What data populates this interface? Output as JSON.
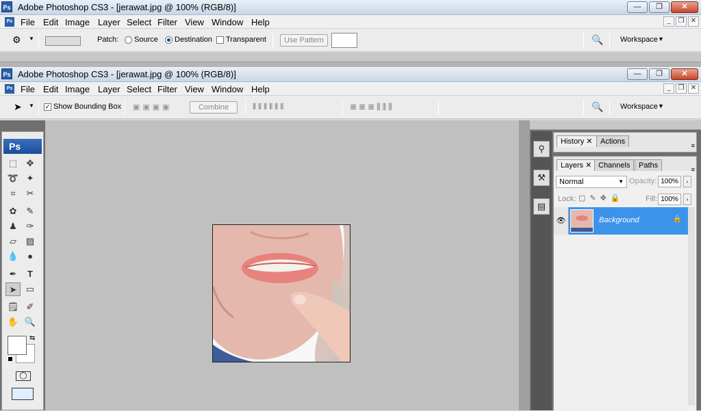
{
  "window1": {
    "title": "Adobe Photoshop CS3 - [jerawat.jpg @ 100% (RGB/8)]",
    "ps": "Ps"
  },
  "window2": {
    "title": "Adobe Photoshop CS3 - [jerawat.jpg @ 100% (RGB/8)]",
    "ps": "Ps"
  },
  "menu": [
    "File",
    "Edit",
    "Image",
    "Layer",
    "Select",
    "Filter",
    "View",
    "Window",
    "Help"
  ],
  "window_buttons": {
    "minimize": "—",
    "restore": "❐",
    "close": "✕"
  },
  "options1": {
    "patch_label": "Patch:",
    "source": "Source",
    "destination": "Destination",
    "transparent": "Transparent",
    "use_pattern": "Use Pattern",
    "workspace": "Workspace"
  },
  "options2": {
    "show_bounding_box": "Show Bounding Box",
    "combine": "Combine",
    "workspace": "Workspace"
  },
  "toolbox": {
    "ps_logo": "Ps"
  },
  "panels": {
    "history_tab": "History",
    "actions_tab": "Actions",
    "layers_tab": "Layers",
    "channels_tab": "Channels",
    "paths_tab": "Paths",
    "blend_mode": "Normal",
    "opacity_label": "Opacity:",
    "opacity_value": "100%",
    "lock_label": "Lock:",
    "fill_label": "Fill:",
    "fill_value": "100%",
    "layer_name": "Background"
  },
  "colors": {
    "accent": "#3b8de6",
    "selected_layer": "#3d93ea"
  }
}
